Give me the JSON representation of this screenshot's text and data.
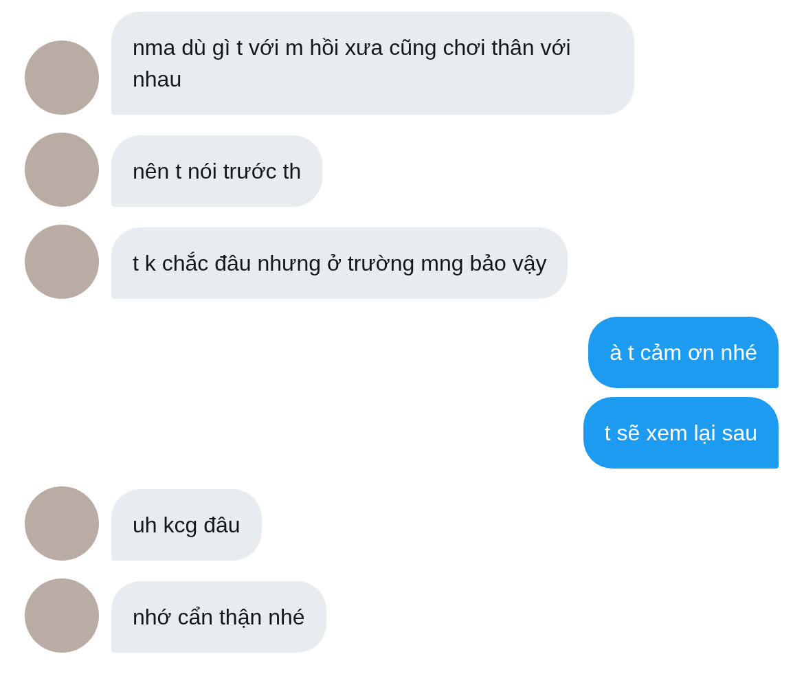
{
  "messages": [
    {
      "kind": "incoming",
      "text": "nma dù gì t với m hồi xưa cũng chơi thân với nhau"
    },
    {
      "kind": "incoming",
      "text": "nên t nói trước th"
    },
    {
      "kind": "incoming",
      "text": "t k chắc đâu nhưng ở trường mng bảo vậy"
    },
    {
      "kind": "outgoing",
      "text": "à t cảm ơn nhé"
    },
    {
      "kind": "outgoing",
      "text": "t sẽ xem lại sau"
    },
    {
      "kind": "incoming",
      "text": "uh kcg đâu"
    },
    {
      "kind": "incoming",
      "text": "nhớ cẩn thận nhé"
    }
  ]
}
